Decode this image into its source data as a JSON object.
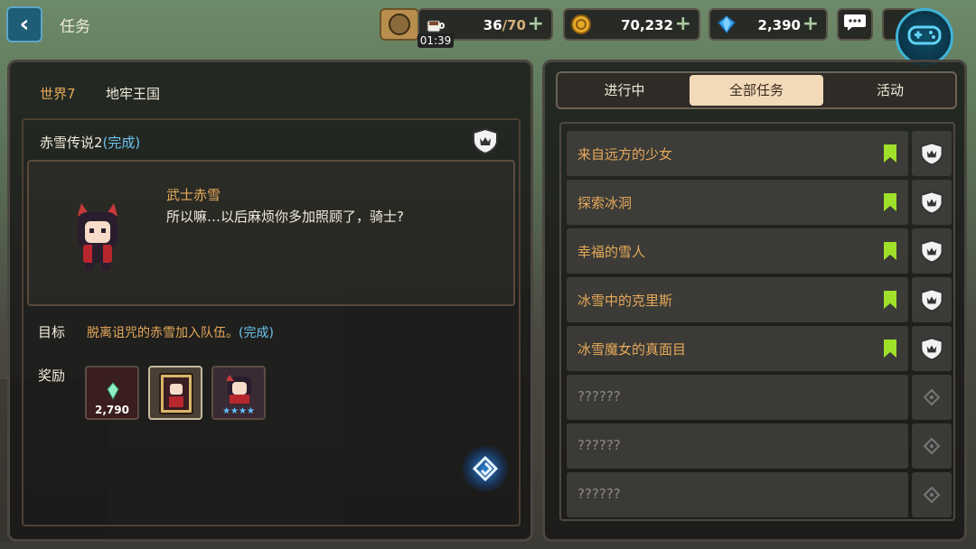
{
  "header": {
    "title": "任务",
    "stamina": {
      "current": "36",
      "max": "70",
      "timer": "01:39"
    },
    "gold": "70,232",
    "gems": "2,390"
  },
  "breadcrumb": {
    "world": "世界7",
    "region": "地牢王国"
  },
  "quest": {
    "title": "赤雪传说2",
    "status": "(完成)",
    "npc_name": "武士赤雪",
    "npc_line": "所以嘛…以后麻烦你多加照顾了，骑士?",
    "goal_label": "目标",
    "goal_text": "脱离诅咒的赤雪加入队伍。",
    "goal_status": "(完成)",
    "reward_label": "奖励",
    "rewards": [
      {
        "icon": "gem-icon",
        "count": "2,790"
      },
      {
        "icon": "hero-card-icon",
        "count": ""
      },
      {
        "icon": "hero-portrait-icon",
        "count": "★★★★"
      }
    ]
  },
  "tabs": [
    {
      "label": "进行中",
      "active": false
    },
    {
      "label": "全部任务",
      "active": true
    },
    {
      "label": "活动",
      "active": false
    }
  ],
  "quests": [
    {
      "name": "来自远方的少女",
      "state": "complete"
    },
    {
      "name": "探索冰洞",
      "state": "complete"
    },
    {
      "name": "幸福的雪人",
      "state": "complete"
    },
    {
      "name": "冰雪中的克里斯",
      "state": "complete"
    },
    {
      "name": "冰雪魔女的真面目",
      "state": "complete"
    },
    {
      "name": "??????",
      "state": "locked"
    },
    {
      "name": "??????",
      "state": "locked"
    },
    {
      "name": "??????",
      "state": "locked"
    }
  ],
  "colors": {
    "accent_orange": "#e6a95a",
    "complete_blue": "#6cc3ef",
    "flag_green": "#9ee02a"
  }
}
